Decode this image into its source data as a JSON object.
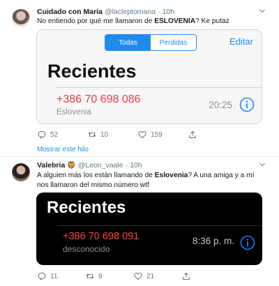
{
  "tweets": [
    {
      "name": "Cuidado con María",
      "handle": "@lacleptomana",
      "time": "10h",
      "text_before": "No entiendo por qué me llamaron de ",
      "text_bold": "ESLOVENIA",
      "text_after": "? Ke putaz",
      "card": {
        "tabs": [
          "Todas",
          "Perdidas"
        ],
        "edit": "Editar",
        "title": "Recientes",
        "number": "+386 70 698 086",
        "location": "Eslovenia",
        "time": "20:25"
      },
      "actions": {
        "replies": "52",
        "retweets": "10",
        "likes": "159"
      }
    },
    {
      "name": "Valebria",
      "badge": "🦁",
      "handle": "@Leon_vaale",
      "time": "10h",
      "text_before": "A alguien más los están llamando de ",
      "text_bold": "Eslovenia",
      "text_after": "? A una amiga y a mí nos llamaron del mismo número wtf",
      "card": {
        "title": "Recientes",
        "number": "+386 70 698 091",
        "location": "desconocido",
        "time": "8:36 p. m."
      },
      "actions": {
        "replies": "11",
        "retweets": "9",
        "likes": "21"
      }
    }
  ],
  "show_thread": "Mostrar este hilo",
  "colors": {
    "link": "#1b95e0",
    "ios_blue": "#1f8af2",
    "missed_call_red": "#f23b3b",
    "muted": "#657786"
  },
  "icons": [
    "chevron-down-icon",
    "reply-icon",
    "retweet-icon",
    "like-icon",
    "share-icon",
    "info-icon"
  ]
}
